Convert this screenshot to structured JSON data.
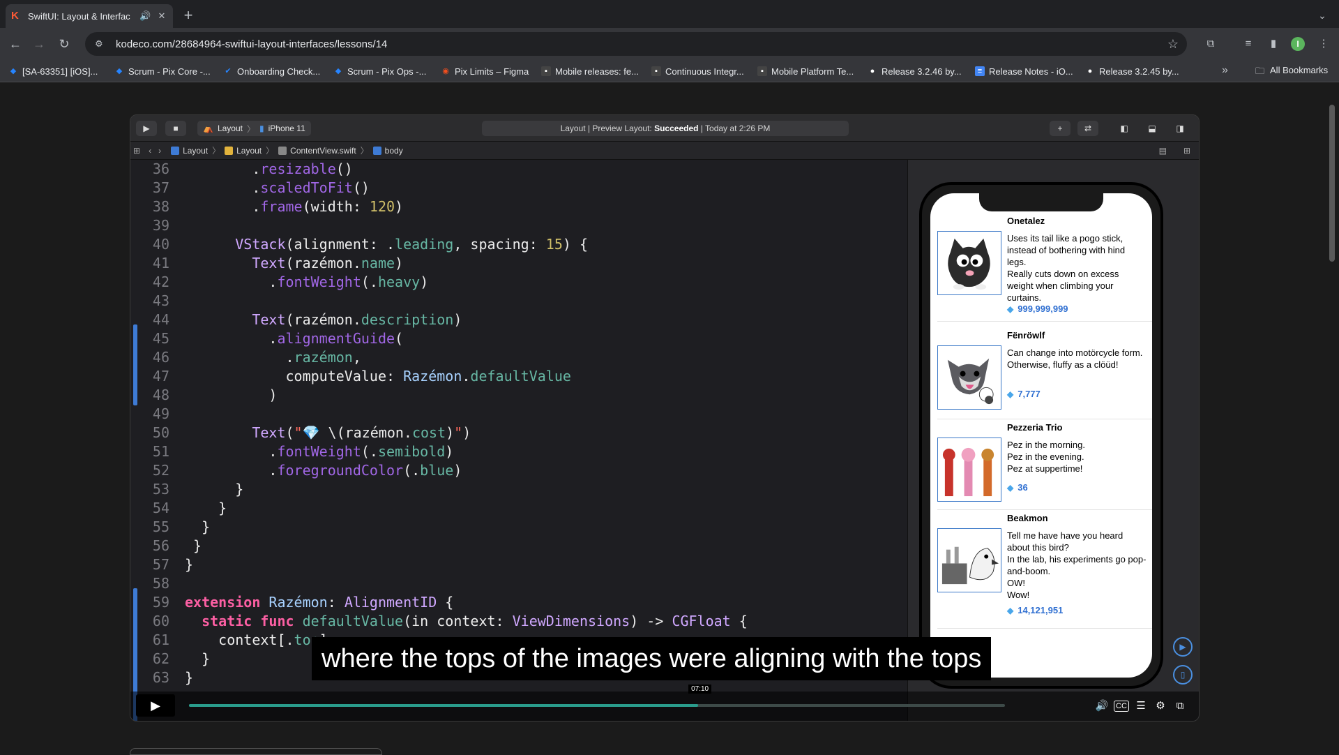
{
  "browser": {
    "tab_title": "SwiftUI: Layout & Interfac",
    "url": "kodeco.com/28684964-swiftui-layout-interfaces/lessons/14",
    "bookmarks": [
      {
        "label": "[SA-63351] [iOS]...",
        "icon_color": "#2684ff"
      },
      {
        "label": "Scrum - Pix Core -...",
        "icon_color": "#2684ff"
      },
      {
        "label": "Onboarding Check...",
        "icon_color": "#2684ff"
      },
      {
        "label": "Scrum - Pix Ops -...",
        "icon_color": "#2684ff"
      },
      {
        "label": "Pix Limits – Figma",
        "icon_color": "#f24e1e"
      },
      {
        "label": "Mobile releases: fe...",
        "icon_color": "#444"
      },
      {
        "label": "Continuous Integr...",
        "icon_color": "#444"
      },
      {
        "label": "Mobile Platform Te...",
        "icon_color": "#444"
      },
      {
        "label": "Release 3.2.46 by...",
        "icon_color": "#fff"
      },
      {
        "label": "Release Notes - iO...",
        "icon_color": "#4285f4"
      },
      {
        "label": "Release 3.2.45 by...",
        "icon_color": "#fff"
      }
    ],
    "all_bookmarks": "All Bookmarks",
    "profile_initial": "I"
  },
  "xcode": {
    "scheme": "Layout",
    "device": "iPhone 11",
    "status_prefix": "Layout | Preview Layout: ",
    "status_result": "Succeeded",
    "status_suffix": " | Today at 2:26 PM",
    "breadcrumb": [
      "Layout",
      "Layout",
      "ContentView.swift",
      "body"
    ]
  },
  "code_lines": [
    36,
    37,
    38,
    39,
    40,
    41,
    42,
    43,
    44,
    45,
    46,
    47,
    48,
    49,
    50,
    51,
    52,
    53,
    54,
    55,
    56,
    57,
    58,
    59,
    60,
    61,
    62,
    63
  ],
  "preview": {
    "items": [
      {
        "name": "Onetalez",
        "description": "Uses its tail like a pogo stick, instead of bothering with hind legs.\nReally cuts down on excess weight when climbing your curtains.",
        "cost": "999,999,999"
      },
      {
        "name": "Fënröwlf",
        "description": "Can change into motörcycle form.\nOtherwise, fluffy as a clöüd!",
        "cost": "7,777"
      },
      {
        "name": "Pezzeria Trio",
        "description": "Pez in the morning.\nPez in the evening.\nPez at suppertime!",
        "cost": "36"
      },
      {
        "name": "Beakmon",
        "description": "Tell me have have you heard about this bird?\nIn the lab, his experiments go pop-and-boom.\n                              OW!\nWow!",
        "cost": "14,121,951"
      }
    ]
  },
  "video": {
    "caption": "where the tops of the images were aligning with the tops",
    "time": "07:10",
    "progress": 0.624
  }
}
